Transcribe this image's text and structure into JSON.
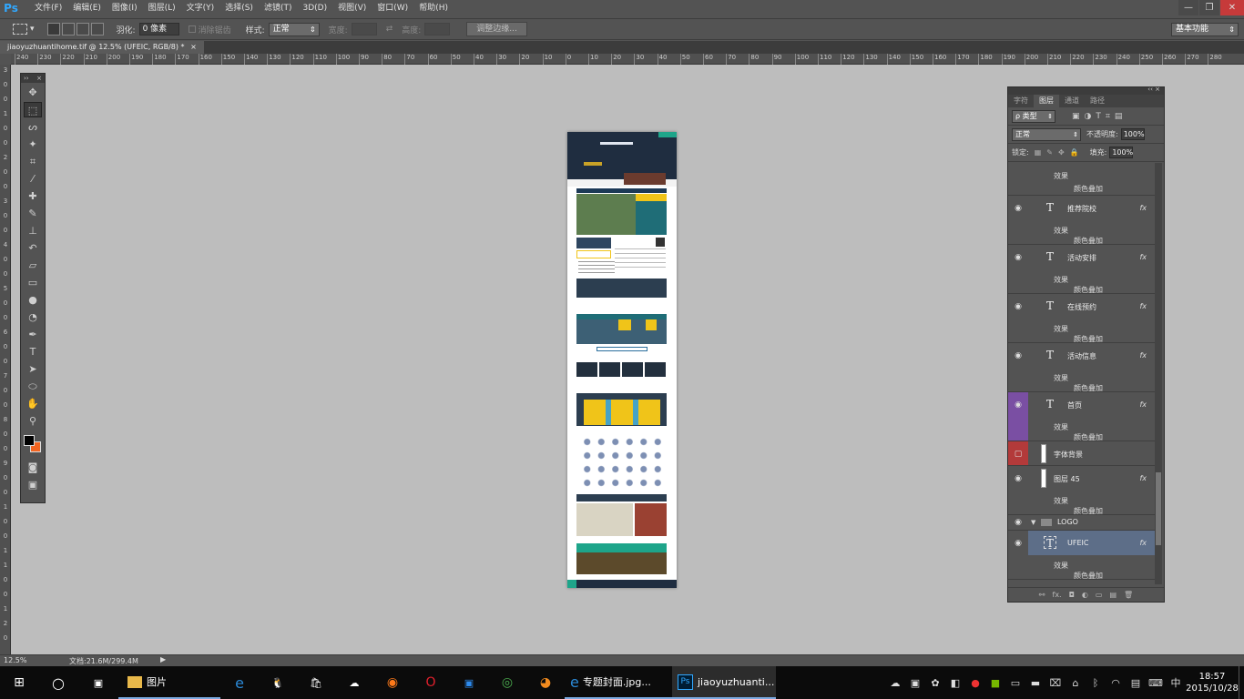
{
  "app": {
    "logo": "Ps"
  },
  "menu": [
    "文件(F)",
    "编辑(E)",
    "图像(I)",
    "图层(L)",
    "文字(Y)",
    "选择(S)",
    "滤镜(T)",
    "3D(D)",
    "视图(V)",
    "窗口(W)",
    "帮助(H)"
  ],
  "window_controls": {
    "minimize": "—",
    "restore": "❐",
    "close": "✕"
  },
  "options": {
    "feather_label": "羽化:",
    "feather_value": "0 像素",
    "antialias_label": "消除锯齿",
    "style_label": "样式:",
    "style_value": "正常",
    "width_label": "宽度:",
    "height_label": "高度:",
    "refine_button": "调整边缘..."
  },
  "workspace": "基本功能",
  "document_tab": {
    "title": "jiaoyuzhuantihome.tif @ 12.5% (UFEIC, RGB/8) *",
    "close": "×"
  },
  "ruler": {
    "h": [
      "240",
      "230",
      "220",
      "210",
      "200",
      "190",
      "180",
      "170",
      "160",
      "150",
      "140",
      "130",
      "120",
      "110",
      "100",
      "90",
      "80",
      "70",
      "60",
      "50",
      "40",
      "30",
      "20",
      "10",
      "0",
      "10",
      "20",
      "30",
      "40",
      "50",
      "60",
      "70",
      "80",
      "90",
      "100",
      "110",
      "120",
      "130",
      "140",
      "150",
      "160",
      "170",
      "180",
      "190",
      "200",
      "210",
      "220",
      "230",
      "240",
      "250",
      "260",
      "270",
      "280"
    ],
    "v": [
      "3",
      "0",
      "0",
      "1",
      "0",
      "0",
      "2",
      "0",
      "0",
      "3",
      "0",
      "0",
      "4",
      "0",
      "0",
      "5",
      "0",
      "0",
      "6",
      "0",
      "0",
      "7",
      "0",
      "0",
      "8",
      "0",
      "0",
      "9",
      "0",
      "0",
      "1",
      "0",
      "0",
      "1",
      "1",
      "0",
      "0",
      "1",
      "2",
      "0"
    ]
  },
  "tools": [
    {
      "name": "move-tool",
      "glyph": "✥"
    },
    {
      "name": "marquee-tool",
      "glyph": "⬚",
      "active": true
    },
    {
      "name": "lasso-tool",
      "glyph": "ᔕ"
    },
    {
      "name": "magic-wand-tool",
      "glyph": "✦"
    },
    {
      "name": "crop-tool",
      "glyph": "⌗"
    },
    {
      "name": "eyedropper-tool",
      "glyph": "⁄"
    },
    {
      "name": "healing-brush-tool",
      "glyph": "✚"
    },
    {
      "name": "brush-tool",
      "glyph": "✎"
    },
    {
      "name": "clone-stamp-tool",
      "glyph": "⊥"
    },
    {
      "name": "history-brush-tool",
      "glyph": "↶"
    },
    {
      "name": "eraser-tool",
      "glyph": "▱"
    },
    {
      "name": "gradient-tool",
      "glyph": "▭"
    },
    {
      "name": "blur-tool",
      "glyph": "●"
    },
    {
      "name": "dodge-tool",
      "glyph": "◔"
    },
    {
      "name": "pen-tool",
      "glyph": "✒"
    },
    {
      "name": "type-tool",
      "glyph": "T"
    },
    {
      "name": "path-selection-tool",
      "glyph": "➤"
    },
    {
      "name": "ellipse-tool",
      "glyph": "⬭"
    },
    {
      "name": "hand-tool",
      "glyph": "✋"
    },
    {
      "name": "zoom-tool",
      "glyph": "⚲"
    }
  ],
  "colors": {
    "foreground": "#000000",
    "background": "#f26522"
  },
  "panel": {
    "tabs": [
      "字符",
      "图层",
      "通道",
      "路径"
    ],
    "active_tab": "图层",
    "filter_value": "ρ 类型",
    "blend_mode": "正常",
    "opacity_label": "不透明度:",
    "opacity_value": "100%",
    "lock_label": "锁定:",
    "fill_label": "填充:",
    "fill_value": "100%"
  },
  "layers": [
    {
      "name": "推荐院校",
      "type": "text",
      "effects_label": "效果",
      "effect": "颜色叠加"
    },
    {
      "name": "活动安排",
      "type": "text",
      "effects_label": "效果",
      "effect": "颜色叠加"
    },
    {
      "name": "在线预约",
      "type": "text",
      "effects_label": "效果",
      "effect": "颜色叠加"
    },
    {
      "name": "活动信息",
      "type": "text",
      "effects_label": "效果",
      "effect": "颜色叠加"
    },
    {
      "name": "首页",
      "type": "text",
      "effects_label": "效果",
      "effect": "颜色叠加",
      "eye_color": "purple"
    },
    {
      "name": "字体背景",
      "type": "shape",
      "eye_color": "red"
    },
    {
      "name": "图层 45",
      "type": "shape",
      "effects_label": "效果",
      "effect": "颜色叠加"
    },
    {
      "name": "LOGO",
      "type": "group"
    },
    {
      "name": "UFEIC",
      "type": "text",
      "effects_label": "效果",
      "effect": "颜色叠加",
      "selected": true
    }
  ],
  "top_partial_layer": {
    "effects_label": "效果",
    "effect": "颜色叠加"
  },
  "status": {
    "zoom": "12.5%",
    "doc": "文档:21.6M/299.4M"
  },
  "taskbar": {
    "items": [
      {
        "name": "photos-app",
        "label": "图片"
      },
      {
        "name": "ie-window",
        "label": "专题封面.jpg..."
      },
      {
        "name": "ps-window",
        "label": "jiaoyuzhuanti..."
      }
    ],
    "ime": "中",
    "time": "18:57",
    "date": "2015/10/28"
  }
}
